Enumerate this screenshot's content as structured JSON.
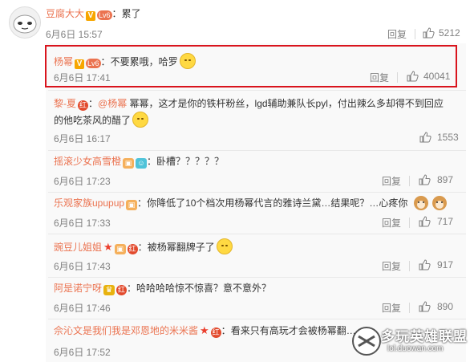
{
  "main_comment": {
    "username": "豆腐大大",
    "badge_v": "V",
    "badge_level": "6",
    "separator": "：",
    "text": "累了",
    "date": "6月6日 15:57",
    "reply_label": "回复",
    "likes": "5212"
  },
  "replies": [
    {
      "username": "杨幂",
      "badge_v": "V",
      "badge_level": "6",
      "separator": "：",
      "text": "不要累哦，哈罗",
      "date": "6月6日 17:41",
      "reply_label": "回复",
      "likes": "40041",
      "highlighted": true
    },
    {
      "username": "黎-夏",
      "badge_red": "红",
      "separator": "：",
      "mention": "@杨幂",
      "text_line1": " 幂幂，这才是你的铁杆粉丝，lgd辅助兼队长pyl，付出辣么多却得不到回应",
      "text_line2": "的他吃茶风的醋了",
      "date": "6月6日 16:17",
      "likes": "1553"
    },
    {
      "username": "摇滚少女高雪橙",
      "separator": "：",
      "text": "卧槽？？？？？",
      "date": "6月6日 17:23",
      "reply_label": "回复",
      "likes": "897"
    },
    {
      "username": "乐观家族upupup",
      "separator": "：",
      "text": "你降低了10个档次用杨幂代言的雅诗兰黛…结果呢？…心疼你",
      "date": "6月6日 17:33",
      "reply_label": "回复",
      "likes": "717"
    },
    {
      "username": "豌豆儿姐姐",
      "badge_red": "红",
      "separator": "：",
      "text": "被杨幂翻牌子了",
      "date": "6月6日 17:43",
      "reply_label": "回复",
      "likes": "917"
    },
    {
      "username": "阿是诺宁呀",
      "badge_red": "红",
      "separator": "：",
      "text": "哈哈哈哈惊不惊喜？意不意外？",
      "date": "6月6日 17:46",
      "reply_label": "回复",
      "likes": "890"
    },
    {
      "username": "佘沁文是我们我是邓恩地的米米酱",
      "badge_red": "红",
      "separator": "：",
      "text": "看来只有高玩才会被杨幂翻……",
      "date": "6月6日 17:52",
      "likes": ""
    }
  ],
  "watermark": {
    "brand": "多玩英雄联盟",
    "url": "lol.duowan.com"
  },
  "colors": {
    "username": "#eb7350",
    "meta": "#808080",
    "highlight_border": "#d9141d"
  }
}
